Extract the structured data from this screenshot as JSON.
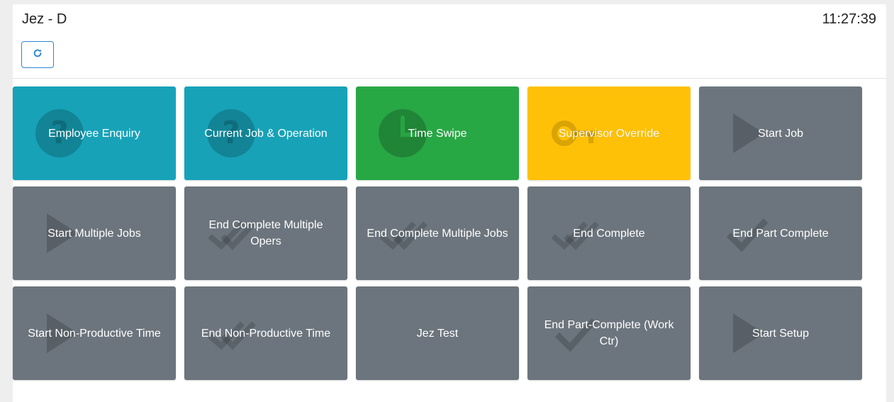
{
  "header": {
    "title": "Jez - D",
    "clock": "11:27:39"
  },
  "refresh": {
    "icon": "refresh-icon"
  },
  "colors": {
    "info": "#17a2b8",
    "success": "#28a745",
    "warning": "#ffc107",
    "secondary": "#6c757d",
    "refresh_accent": "#2f86d6"
  },
  "tiles": [
    {
      "label": "Employee Enquiry",
      "icon": "question-icon",
      "style": "info"
    },
    {
      "label": "Current Job & Operation",
      "icon": "question-icon",
      "style": "info"
    },
    {
      "label": "Time Swipe",
      "icon": "clock-icon",
      "style": "success"
    },
    {
      "label": "Supervisor Override",
      "icon": "key-icon",
      "style": "warning"
    },
    {
      "label": "Start Job",
      "icon": "play-icon",
      "style": "secondary"
    },
    {
      "label": "Start Multiple Jobs",
      "icon": "play-icon",
      "style": "secondary"
    },
    {
      "label": "End Complete Multiple Opers",
      "icon": "double-check-icon",
      "style": "secondary"
    },
    {
      "label": "End Complete Multiple Jobs",
      "icon": "double-check-icon",
      "style": "secondary"
    },
    {
      "label": "End Complete",
      "icon": "double-check-icon",
      "style": "secondary"
    },
    {
      "label": "End Part Complete",
      "icon": "check-icon",
      "style": "secondary"
    },
    {
      "label": "Start Non-Productive Time",
      "icon": "play-icon",
      "style": "secondary"
    },
    {
      "label": "End Non-Productive Time",
      "icon": "double-check-icon",
      "style": "secondary"
    },
    {
      "label": "Jez Test",
      "icon": "",
      "style": "secondary"
    },
    {
      "label": "End Part-Complete (Work Ctr)",
      "icon": "check-icon",
      "style": "secondary"
    },
    {
      "label": "Start Setup",
      "icon": "play-icon",
      "style": "secondary"
    }
  ]
}
